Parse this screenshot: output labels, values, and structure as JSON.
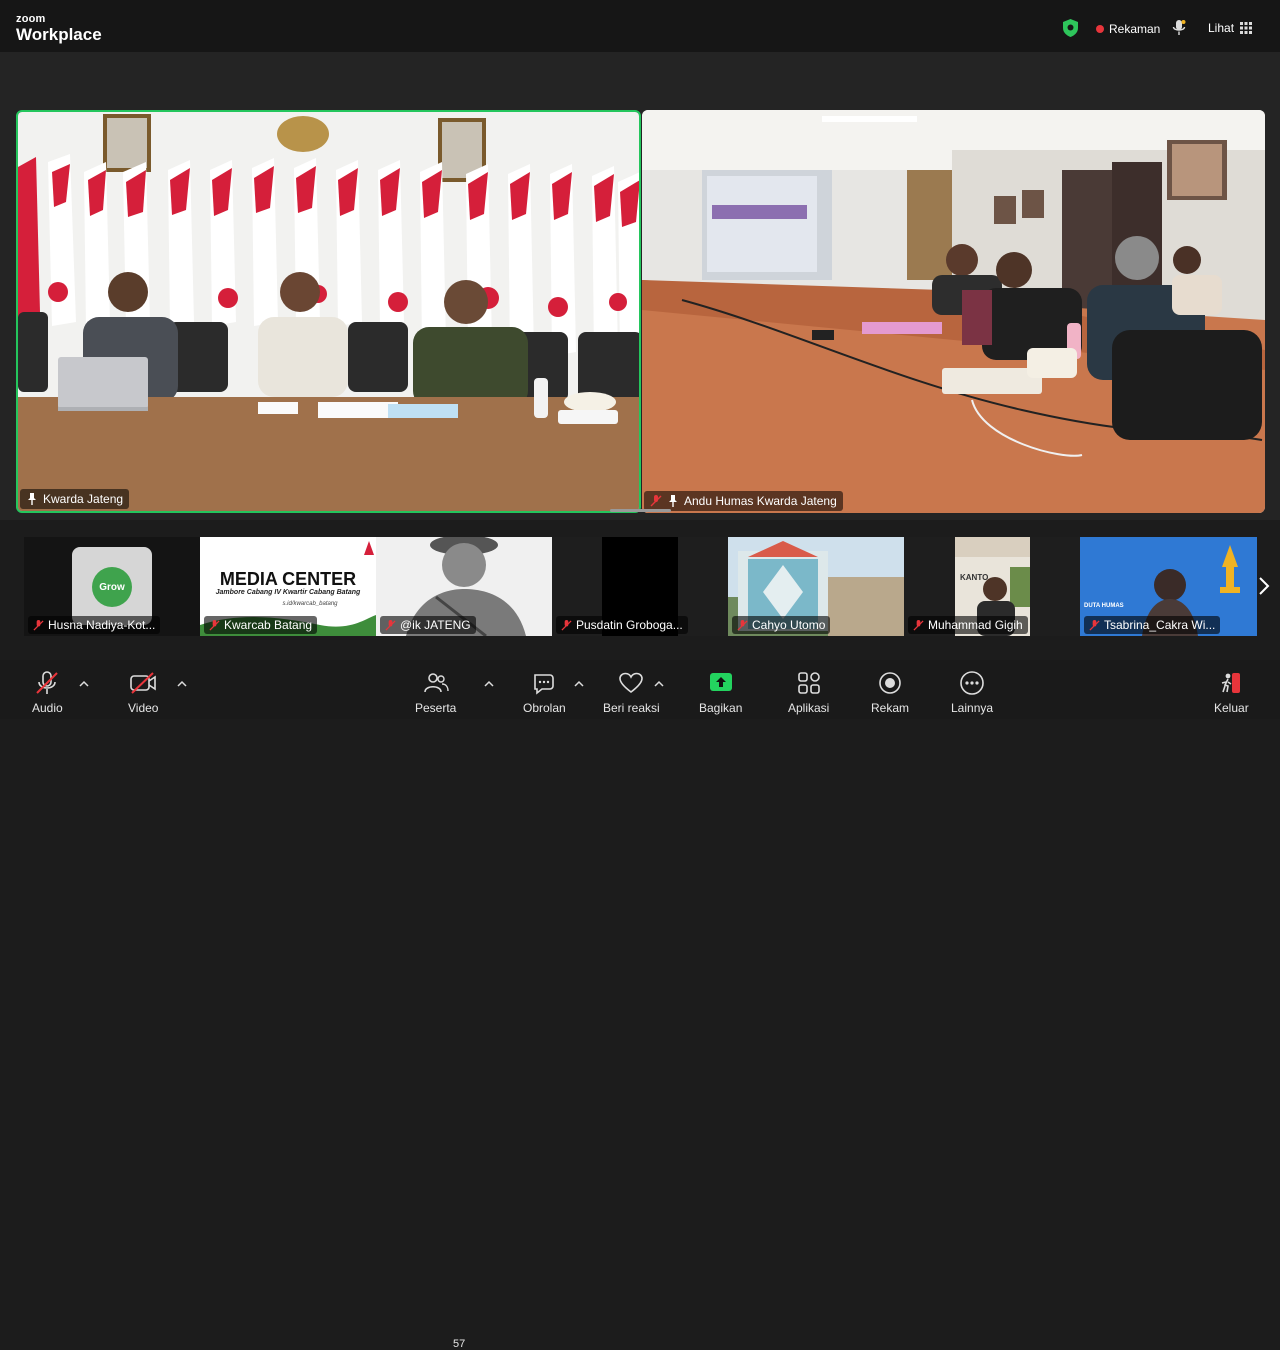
{
  "app": {
    "brand_small": "zoom",
    "brand_big": "Workplace"
  },
  "topbar": {
    "recording_label": "Rekaman",
    "view_label": "Lihat",
    "recording_color": "#e8353b",
    "security_color": "#2ec55b"
  },
  "main_videos": [
    {
      "name": "Kwarda Jateng",
      "active_speaker": true,
      "muted": false
    },
    {
      "name": "Andu Humas Kwarda Jateng",
      "active_speaker": false,
      "muted": true
    }
  ],
  "filmstrip": [
    {
      "name": "Husna Nadiya-Kot...",
      "muted": true,
      "logo_text": "Grow"
    },
    {
      "name": "Kwarcab Batang",
      "muted": true,
      "banner_title": "MEDIA CENTER",
      "banner_sub": "Jambore Cabang IV Kwartir Cabang Batang",
      "banner_link": "s.id/kwarcab_batang"
    },
    {
      "name": "@ik JATENG",
      "muted": true
    },
    {
      "name": "Pusdatin Groboga...",
      "muted": true
    },
    {
      "name": "Cahyo Utomo",
      "muted": true
    },
    {
      "name": "Muhammad Gigih",
      "muted": true,
      "sign_text": "KANTO"
    },
    {
      "name": "Tsabrina_Cakra Wi...",
      "muted": true,
      "banner_title": "DUTA HUMAS"
    }
  ],
  "toolbar": {
    "audio": "Audio",
    "video": "Video",
    "participants": "Peserta",
    "participants_count": "57",
    "chat": "Obrolan",
    "react": "Beri reaksi",
    "share": "Bagikan",
    "apps": "Aplikasi",
    "record": "Rekam",
    "more": "Lainnya",
    "leave": "Keluar",
    "share_color": "#23d35f",
    "leave_color": "#e8353b"
  },
  "colors": {
    "active_border": "#24c65d",
    "muted_red": "#e8353b"
  }
}
